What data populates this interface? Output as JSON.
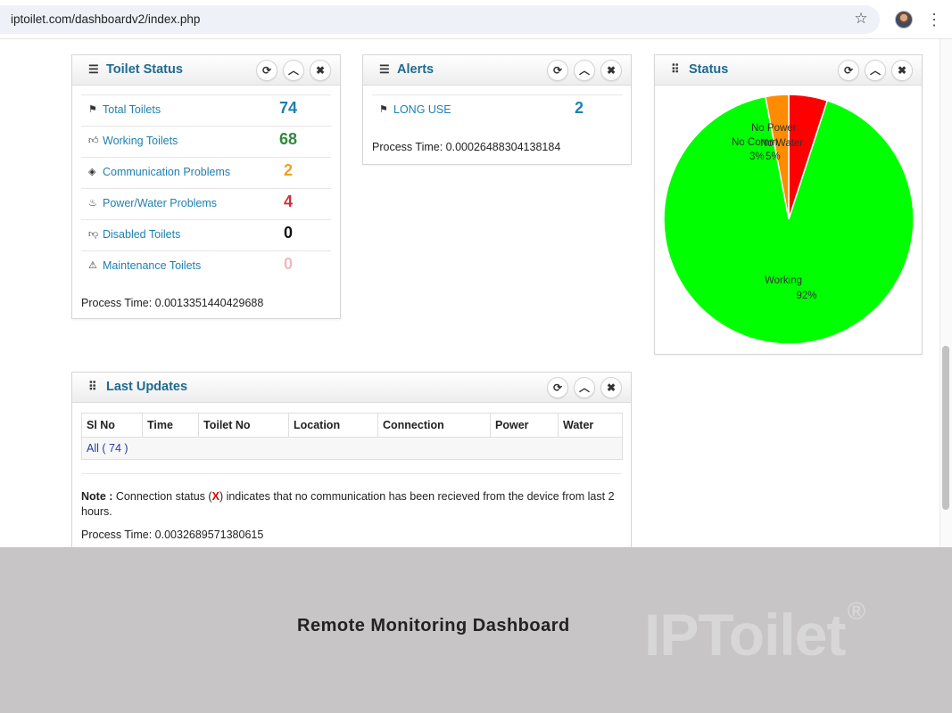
{
  "browser": {
    "url": "iptoilet.com/dashboardv2/index.php",
    "bookmark_icon": "star-icon",
    "menu_icon": "kebab-menu-icon"
  },
  "colors": {
    "title_blue": "#1f6a8e",
    "link_blue": "#1f7fb0",
    "working_green": "#00ff00",
    "no_comm_orange": "#ff8c00",
    "no_power_red": "#ff0000"
  },
  "toolbar_icons": [
    "refresh-icon",
    "collapse-icon",
    "close-icon"
  ],
  "toilet_status": {
    "title": "Toilet Status",
    "title_icon": "list-icon",
    "rows": [
      {
        "icon": "flag-icon",
        "label": "Total Toilets",
        "value": "74",
        "color": "#1f7fb0"
      },
      {
        "icon": "thumbs-up-icon",
        "label": "Working Toilets",
        "value": "68",
        "color": "#2e8b3a"
      },
      {
        "icon": "signal-icon",
        "label": "Communication Problems",
        "value": "2",
        "color": "#f0a020"
      },
      {
        "icon": "fire-icon",
        "label": "Power/Water Problems",
        "value": "4",
        "color": "#c8323a"
      },
      {
        "icon": "thumbs-down-icon",
        "label": "Disabled Toilets",
        "value": "0",
        "color": "#111111"
      },
      {
        "icon": "warning-icon",
        "label": "Maintenance Toilets",
        "value": "0",
        "color": "#f2b6c2"
      }
    ],
    "process_time": "Process Time: 0.0013351440429688"
  },
  "alerts": {
    "title": "Alerts",
    "title_icon": "list-icon",
    "rows": [
      {
        "icon": "flag-icon",
        "label": "LONG USE",
        "value": "2"
      }
    ],
    "process_time": "Process Time: 0.00026488304138184"
  },
  "status": {
    "title": "Status",
    "title_icon": "grid-icon",
    "labels": {
      "working": "Working",
      "working_pct": "92%",
      "no_comm": "No Comm",
      "no_comm_pct": "3%",
      "no_power": "No Power",
      "no_water": "No Water",
      "no_power_pct": "5%"
    }
  },
  "chart_data": {
    "type": "pie",
    "categories": [
      "Working",
      "No Communication",
      "No Power / No Water"
    ],
    "values": [
      92,
      3,
      5
    ],
    "colors": [
      "#00ff00",
      "#ff8c00",
      "#ff0000"
    ]
  },
  "last_updates": {
    "title": "Last Updates",
    "title_icon": "grid-icon",
    "columns": [
      "Sl No",
      "Time",
      "Toilet No",
      "Location",
      "Connection",
      "Power",
      "Water"
    ],
    "all_link": "All ( 74 )",
    "note_prefix": "Note :",
    "note_part1": " Connection status (",
    "note_x": "X",
    "note_part2": ") indicates that no communication has been recieved from the device from last 2 hours.",
    "process_time": "Process Time: 0.0032689571380615"
  },
  "banner": {
    "caption": "Remote Monitoring Dashboard",
    "logo": "IPToilet",
    "logo_mark": "®"
  }
}
